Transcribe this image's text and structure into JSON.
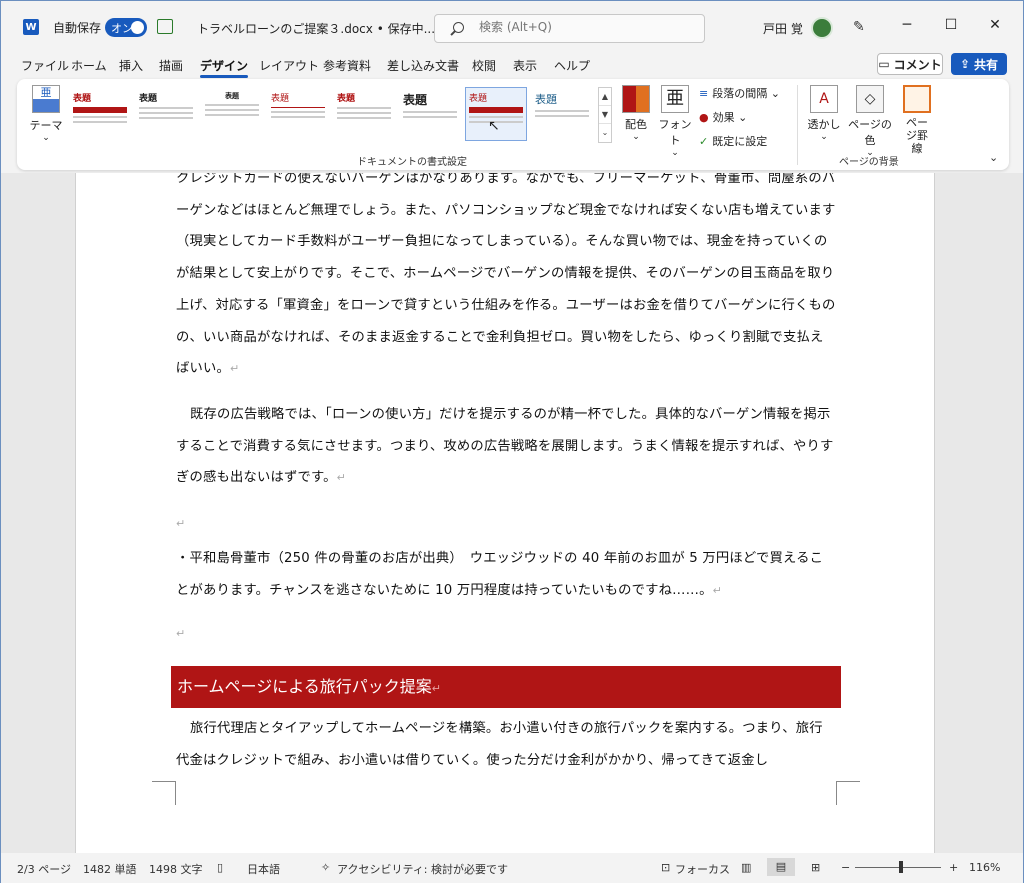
{
  "titlebar": {
    "autosave_label": "自動保存",
    "autosave_state": "オン",
    "doc_title": "トラベルローンのご提案３.docx • 保存中... ⌄",
    "search_placeholder": "検索 (Alt+Q)",
    "user_name": "戸田 覚",
    "minimize": "─",
    "maximize": "☐",
    "close": "✕"
  },
  "menu": {
    "items": [
      "ファイル",
      "ホーム",
      "挿入",
      "描画",
      "デザイン",
      "レイアウト",
      "参考資料",
      "差し込み文書",
      "校閲",
      "表示",
      "ヘルプ"
    ],
    "active": "デザイン",
    "comment": "コメント",
    "share": "共有"
  },
  "ribbon": {
    "theme": "テーマ",
    "gallery": [
      {
        "h": "表題",
        "color": "#b01515"
      },
      {
        "h": "表題",
        "color": "#222222"
      },
      {
        "h": "表題",
        "color": "#222222"
      },
      {
        "h": "表題",
        "color": "#b01515"
      },
      {
        "h": "表題",
        "color": "#b01515"
      },
      {
        "h": "表題",
        "color": "#222222"
      },
      {
        "h": "表題",
        "color": "#b01515"
      },
      {
        "h": "表題",
        "color": "#1f5f8a"
      }
    ],
    "doc_format_label": "ドキュメントの書式設定",
    "colors": "配色",
    "fonts": "フォント",
    "fonts_glyph": "亜",
    "paragraph_spacing": "段落の間隔 ⌄",
    "effects": "効果 ⌄",
    "set_default": "既定に設定",
    "watermark": "透かし",
    "page_color": "ページの色",
    "page_border": "ページ罫線",
    "page_bg_label": "ページの背景"
  },
  "document": {
    "p1": "クレジットカードの使えないバーゲンはかなりあります。なかでも、フリーマーケット、骨董市、問屋系のバーゲンなどはほとんど無理でしょう。また、パソコンショップなど現金でなければ安くない店も増えています（現実としてカード手数料がユーザー負担になってしまっている）。そんな買い物では、現金を持っていくのが結果として安上がりです。そこで、ホームページでバーゲンの情報を提供、そのバーゲンの目玉商品を取り上げ、対応する「軍資金」をローンで貸すという仕組みを作る。ユーザーはお金を借りてバーゲンに行くものの、いい商品がなければ、そのまま返金することで金利負担ゼロ。買い物をしたら、ゆっくり割賦で支払えばいい。",
    "p2": "既存の広告戦略では、「ローンの使い方」だけを提示するのが精一杯でした。具体的なバーゲン情報を掲示することで消費する気にさせます。つまり、攻めの広告戦略を展開します。うまく情報を提示すれば、やりすぎの感も出ないはずです。",
    "p3": "・平和島骨董市（250 件の骨董のお店が出典）　ウエッジウッドの 40 年前のお皿が 5 万円ほどで買えることがあります。チャンスを逃さないために 10 万円程度は持っていたいものですね……。",
    "heading": "ホームページによる旅行パック提案",
    "p4": "旅行代理店とタイアップしてホームページを構築。お小遣い付きの旅行パックを案内する。つまり、旅行代金はクレジットで組み、お小遣いは借りていく。使った分だけ金利がかかり、帰ってきて返金し",
    "mark": "↵"
  },
  "status": {
    "page": "2/3 ページ",
    "words": "1482 単語",
    "chars": "1498 文字",
    "lang": "日本語",
    "accessibility": "アクセシビリティ: 検討が必要です",
    "focus": "フォーカス",
    "zoom_minus": "−",
    "zoom_plus": "+",
    "zoom": "116%"
  },
  "colors": {
    "accent": "#185abd",
    "heading_bg": "#b01515"
  }
}
